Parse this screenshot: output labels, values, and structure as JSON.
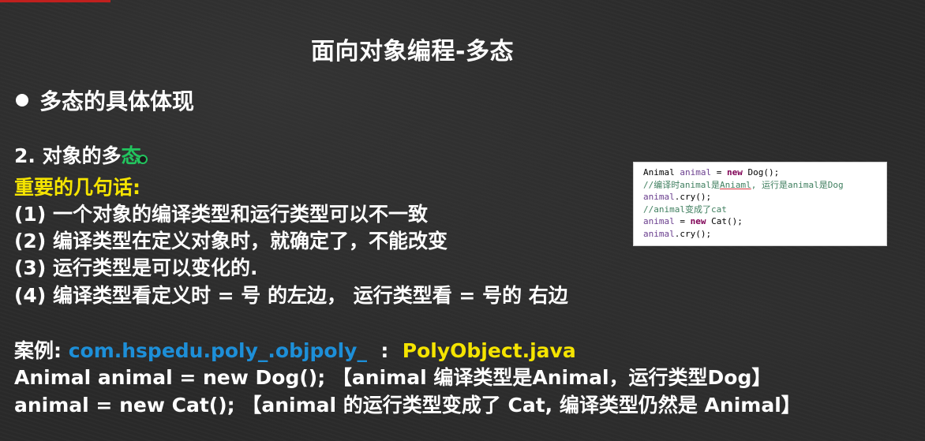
{
  "title": "面向对象编程-多态",
  "bullet": "多态的具体体现",
  "section": {
    "heading_main": "2.  对象的多",
    "heading_last_char": "态"
  },
  "important": "重要的几句话:",
  "points": [
    "(1) 一个对象的编译类型和运行类型可以不一致",
    "(2) 编译类型在定义对象时，就确定了，不能改变",
    "(3) 运行类型是可以变化的.",
    "(4) 编译类型看定义时 = 号 的左边， 运行类型看 = 号的 右边"
  ],
  "example": {
    "label": "案例: ",
    "package": "com.hspedu.poly_.objpoly_",
    "separator": "  :  ",
    "file": "PolyObject.java",
    "line1": "Animal animal = new Dog();  【animal 编译类型是Animal，运行类型Dog】",
    "line2": "animal = new Cat(); 【animal 的运行类型变成了 Cat, 编译类型仍然是 Animal】"
  },
  "code": {
    "l1_type": "Animal ",
    "l1_var": "animal",
    "l1_eq": " = ",
    "l1_new": "new",
    "l1_rest": " Dog();",
    "l2_a": "//编译时animal是",
    "l2_b": "Aniaml",
    "l2_c": ", 运行是animal是Dog",
    "l3_var": "animal",
    "l3_rest": ".cry();",
    "l4": "//animal变成了cat",
    "l5_var": "animal",
    "l5_eq": " = ",
    "l5_new": "new",
    "l5_rest": " Cat();",
    "l6_var": "animal",
    "l6_rest": ".cry();"
  },
  "colors": {
    "background": "#2a2a2a",
    "highlight_yellow": "#f5e400",
    "link_blue": "#1d8fd8",
    "accent_red": "#c0201e"
  }
}
